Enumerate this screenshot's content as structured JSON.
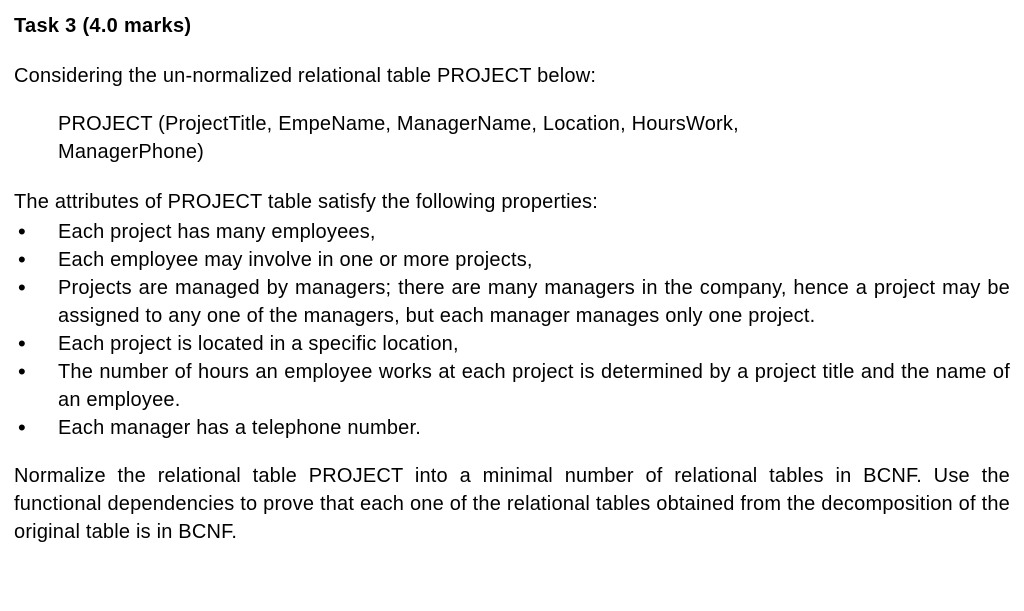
{
  "heading": "Task 3 (4.0 marks)",
  "intro": "Considering the un-normalized relational table PROJECT below:",
  "schema_line1": "PROJECT (ProjectTitle, EmpeName, ManagerName, Location, HoursWork,",
  "schema_line2": "ManagerPhone)",
  "properties_intro": "The attributes of PROJECT table satisfy the following properties:",
  "bullets": [
    "Each project has many employees,",
    "Each employee may involve in one or more projects,",
    "Projects are managed by managers; there are many managers in the company, hence a project may be assigned to any one of the managers, but each manager manages only one project.",
    "Each project is located in a specific location,",
    "The number of hours an employee works at each project is determined by a project title and the name of an employee.",
    "Each manager has a telephone number."
  ],
  "final": "Normalize the relational table PROJECT into a minimal number of relational tables in BCNF. Use the functional dependencies to prove that each one of the relational tables obtained from the decomposition of the original table is in BCNF."
}
